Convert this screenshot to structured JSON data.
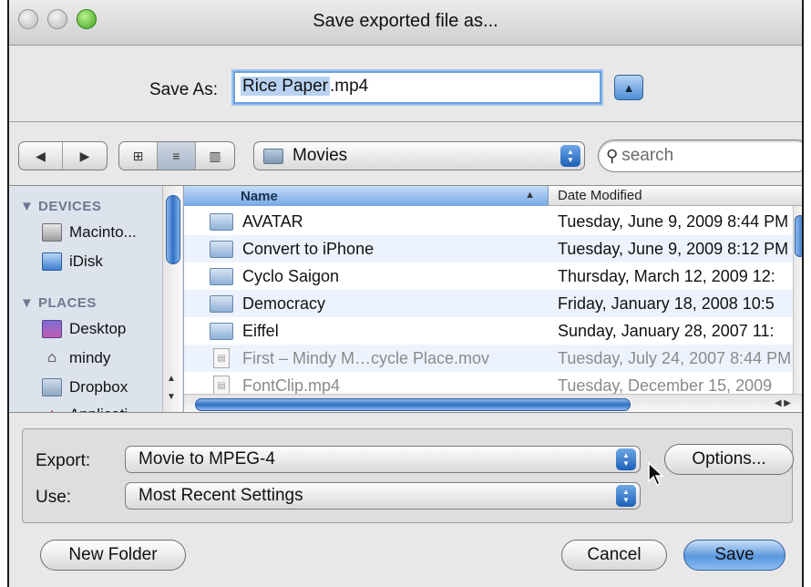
{
  "window": {
    "title": "Save exported file as..."
  },
  "saveas": {
    "label": "Save As:",
    "filename_base": "Rice Paper",
    "filename_ext": ".mp4"
  },
  "toolbar": {
    "back_glyph": "◀",
    "forward_glyph": "▶",
    "view_icon_glyph": "⊞",
    "view_list_glyph": "≡",
    "view_column_glyph": "▥",
    "location": "Movies",
    "search_placeholder": "search",
    "search_glyph": "⚲"
  },
  "sidebar": {
    "devices_heading": "▼ DEVICES",
    "devices": [
      {
        "label": "Macinto...",
        "icon": "hard-disk-icon"
      },
      {
        "label": "iDisk",
        "icon": "idisk-icon"
      }
    ],
    "places_heading": "▼ PLACES",
    "places": [
      {
        "label": "Desktop",
        "icon": "desktop-icon"
      },
      {
        "label": "mindy",
        "icon": "home-icon"
      },
      {
        "label": "Dropbox",
        "icon": "dropbox-folder-icon"
      },
      {
        "label": "Applicati...",
        "icon": "applications-icon"
      }
    ]
  },
  "list": {
    "columns": {
      "name": "Name",
      "date": "Date Modified"
    },
    "rows": [
      {
        "name": "AVATAR",
        "date": "Tuesday, June 9, 2009 8:44 PM",
        "kind": "folder"
      },
      {
        "name": "Convert to iPhone",
        "date": "Tuesday, June 9, 2009 8:12 PM",
        "kind": "folder"
      },
      {
        "name": "Cyclo Saigon",
        "date": "Thursday, March 12, 2009 12:",
        "kind": "folder"
      },
      {
        "name": "Democracy",
        "date": "Friday, January 18, 2008 10:5",
        "kind": "folder"
      },
      {
        "name": "Eiffel",
        "date": "Sunday, January 28, 2007 11:",
        "kind": "folder"
      },
      {
        "name": "First – Mindy M…cycle Place.mov",
        "date": "Tuesday, July 24, 2007 8:44 PM",
        "kind": "file"
      },
      {
        "name": "FontClip.mp4",
        "date": "Tuesday, December 15, 2009",
        "kind": "file"
      }
    ]
  },
  "options": {
    "export_label": "Export:",
    "export_value": "Movie to MPEG-4",
    "use_label": "Use:",
    "use_value": "Most Recent Settings",
    "options_button": "Options..."
  },
  "footer": {
    "new_folder": "New Folder",
    "cancel": "Cancel",
    "save": "Save"
  }
}
